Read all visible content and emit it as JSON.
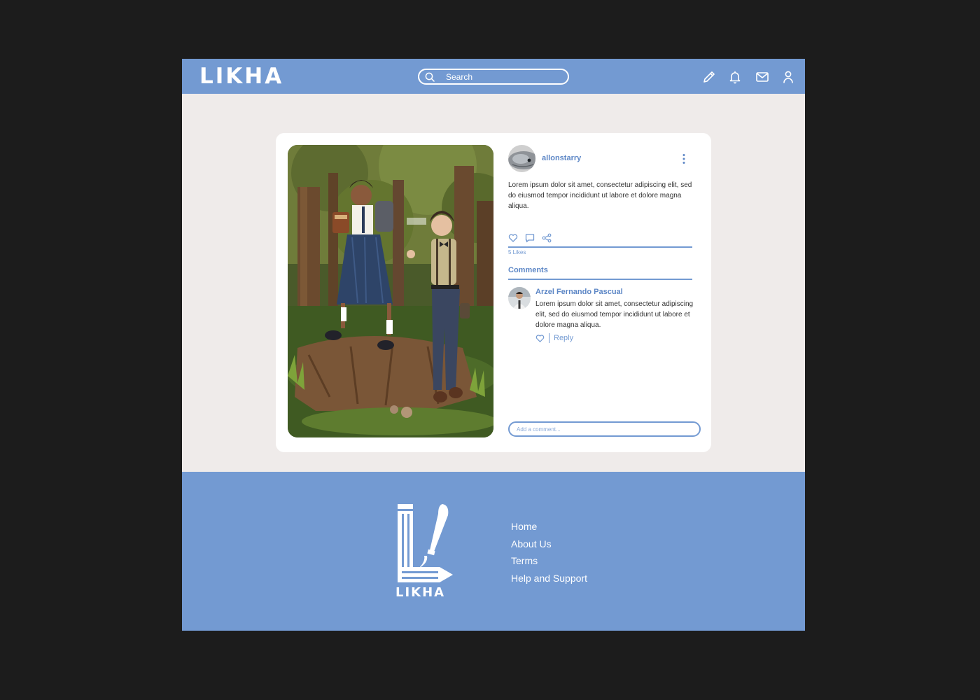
{
  "brand": {
    "name": "LIKHA"
  },
  "header": {
    "search_placeholder": "Search",
    "icons": [
      "pencil-icon",
      "bell-icon",
      "mail-icon",
      "user-icon"
    ]
  },
  "post": {
    "username": "allonstarry",
    "caption": "Lorem ipsum dolor sit amet, consectetur adipiscing elit, sed do eiusmod tempor incididunt ut labore et dolore magna aliqua.",
    "likes_text": "5 Likes",
    "comments_heading": "Comments",
    "comment_placeholder": "Add a comment...",
    "comments": [
      {
        "author": "Arzel Fernando Pascual",
        "text": "Lorem ipsum dolor sit amet, consectetur adipiscing elit, sed do eiusmod tempor incididunt ut labore et dolore magna aliqua.",
        "reply_label": "Reply"
      }
    ]
  },
  "footer": {
    "links": [
      "Home",
      "About Us",
      "Terms",
      "Help and Support"
    ]
  },
  "colors": {
    "background": "#1c1c1c",
    "accent": "#739ad2",
    "page": "#efebea",
    "card": "#ffffff",
    "text_dark": "#333333"
  }
}
